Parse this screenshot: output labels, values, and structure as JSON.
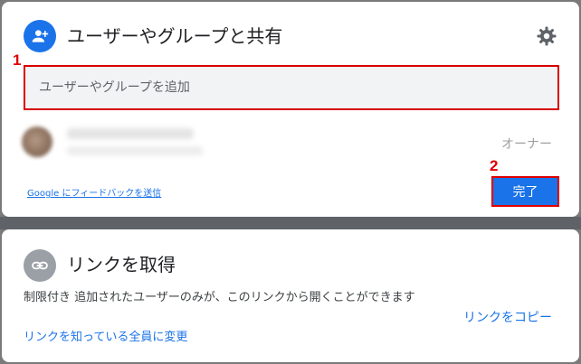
{
  "share_dialog": {
    "title": "ユーザーやグループと共有",
    "title_icon": "person-add-icon",
    "settings_icon": "gear-icon",
    "search": {
      "placeholder": "ユーザーやグループを追加",
      "value": ""
    },
    "member": {
      "role": "オーナー"
    },
    "feedback_link": "Google にフィードバックを送信",
    "done_button": "完了",
    "annotations": [
      "1",
      "2"
    ],
    "accent_color": "#1a73e8",
    "annotation_color": "#e00000"
  },
  "link_dialog": {
    "title": "リンクを取得",
    "title_icon": "link-icon",
    "description_strong": "制限付き",
    "description": "追加されたユーザーのみが、このリンクから開くことができます",
    "change_link": "リンクを知っている全員に変更",
    "copy_link": "リンクをコピー"
  }
}
